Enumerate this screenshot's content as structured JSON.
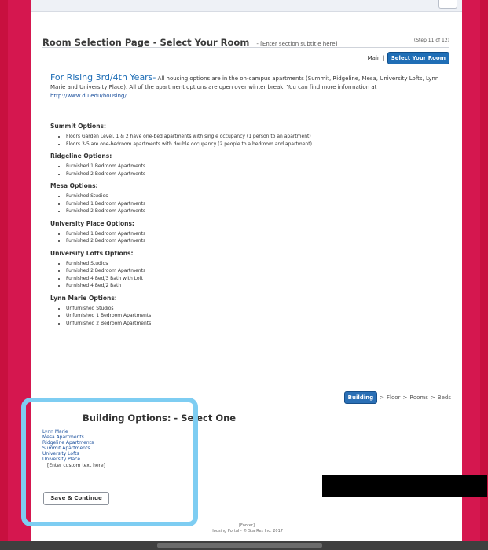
{
  "header": {
    "title": "Room Selection Page - Select Your Room",
    "subtitle": "- [Enter section subtitle here]",
    "step": "(Step 11 of 12)"
  },
  "nav": {
    "main_label": "Main",
    "separator": "|",
    "select_label": "Select Your Room"
  },
  "intro": {
    "lead": "For Rising 3rd/4th Years-",
    "text": " All housing options are in the on-campus apartments (Summit, Ridgeline, Mesa, University Lofts, Lynn Marie and University Place).  All of the apartment options are open over winter break. You can find more information at ",
    "link": "http://www.du.edu/housing/",
    "tail": "."
  },
  "options": [
    {
      "heading": "Summit Options:",
      "items": [
        "Floors Garden Level, 1 & 2 have one-bed apartments with single occupancy (1 person to an apartment)",
        "Floors 3-5 are one-bedroom apartments with double occupancy (2 people to a bedroom and apartment)"
      ]
    },
    {
      "heading": "Ridgeline Options:",
      "items": [
        "Furnished 1 Bedroom Apartments",
        "Furnished 2 Bedroom Apartments"
      ]
    },
    {
      "heading": "Mesa Options:",
      "items": [
        "Furnished Studios",
        "Furnished 1 Bedroom Apartments",
        "Furnished 2 Bedroom Apartments"
      ]
    },
    {
      "heading": "University Place Options:",
      "items": [
        "Furnished 1 Bedroom Apartments",
        "Furnished 2 Bedroom Apartments"
      ]
    },
    {
      "heading": "University Lofts Options:",
      "items": [
        "Furnished Studios",
        "Furnished 2 Bedroom Apartments",
        "Furnished 4 Bed/3 Bath with Loft",
        "Furnished 4 Bed/2 Bath"
      ]
    },
    {
      "heading": "Lynn Marie Options:",
      "items": [
        "Unfurnished Studios",
        "Unfurnished 1 Bedroom Apartments",
        "Unfurnished 2 Bedroom Apartments"
      ]
    }
  ],
  "breadcrumb": {
    "building": "Building",
    "floor": "Floor",
    "rooms": "Rooms",
    "beds": "Beds",
    "separator": ">"
  },
  "building_options": {
    "title": "Building Options: - Select One",
    "buildings": [
      "Lynn Marie",
      "Mesa Apartments",
      "Ridgeline Apartments",
      "Summit Apartments",
      "University Lofts",
      "University Place"
    ],
    "custom_text": "[Enter custom text here]",
    "save_label": "Save & Continue"
  },
  "footer": {
    "line1": "[Footer]",
    "line2": "Housing Portal - © StarRez Inc. 2017"
  },
  "colors": {
    "background": "#d5174f",
    "accent": "#1f6eb6",
    "highlight_border": "#7ecdf2"
  }
}
